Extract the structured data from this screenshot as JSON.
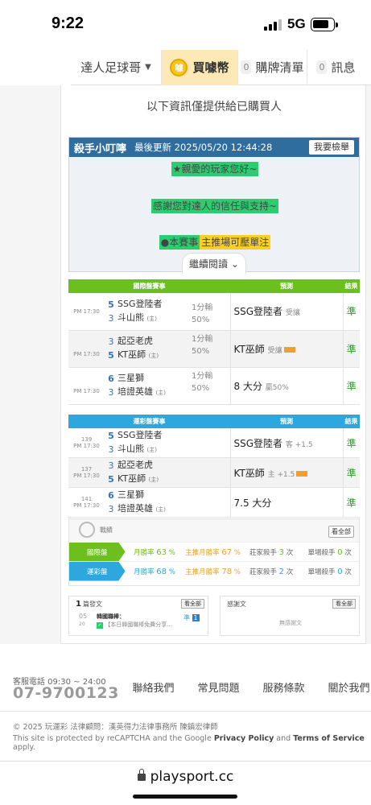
{
  "status": {
    "time": "9:22",
    "network": "5G"
  },
  "nav": {
    "user_label": "達人足球哥",
    "coin_label": "買噱幣",
    "coin_badge": "噱",
    "list_count": "0",
    "list_label": "購牌清單",
    "msg_count": "0",
    "msg_label": "訊息"
  },
  "notice": "以下資訊僅提供給已購買人",
  "killer": {
    "title": "殺手小叮嚀",
    "updated": "最後更新 2025/05/20 12:44:28",
    "report": "我要檢舉",
    "line1": "★親愛的玩家您好~",
    "line2": "感謝您對達人的信任與支持~",
    "line3a": "●本賽事",
    "line3b": "主推場可壓單注",
    "more": "繼續閱讀"
  },
  "intl": {
    "header": [
      "國際盤賽事",
      "預測",
      "結果"
    ],
    "rows": [
      {
        "time": "PM 17:30",
        "n1": "5",
        "t1": "SSG登陸者",
        "n2": "3",
        "t2": "斗山熊",
        "home": "(主)",
        "odds1": "1分輸",
        "odds2": "50%",
        "pick": "SSG登陸者",
        "sub": "受讓",
        "result": "準"
      },
      {
        "time": "PM 17:30",
        "n1": "3",
        "t1": "起亞老虎",
        "n2": "5",
        "t2": "KT巫師",
        "home": "(主)",
        "odds1": "1分輸",
        "odds2": "50%",
        "pick": "KT巫師",
        "sub": "受讓",
        "result": "準"
      },
      {
        "time": "PM 17:30",
        "n1": "6",
        "t1": "三星獅",
        "n2": "3",
        "t2": "培證英雄",
        "home": "(主)",
        "odds1": "1分輸",
        "odds2": "50%",
        "pick": "8 大分",
        "sub": "贏50%",
        "result": "準"
      }
    ]
  },
  "lottery": {
    "header": [
      "運彩盤賽事",
      "預測",
      "結果"
    ],
    "rows": [
      {
        "no": "139",
        "time": "PM 17:30",
        "n1": "5",
        "t1": "SSG登陸者",
        "n2": "3",
        "t2": "斗山熊",
        "home": "(主)",
        "pick": "SSG登陸者",
        "sub": "客 +1.5",
        "result": "準"
      },
      {
        "no": "137",
        "time": "PM 17:30",
        "n1": "3",
        "t1": "起亞老虎",
        "n2": "5",
        "t2": "KT巫師",
        "home": "(主)",
        "pick": "KT巫師",
        "sub": "主 +1.5",
        "result": "準"
      },
      {
        "no": "141",
        "time": "PM 17:30",
        "n1": "6",
        "t1": "三星獅",
        "n2": "3",
        "t2": "培證英雄",
        "home": "(主)",
        "pick": "7.5 大分",
        "sub": "",
        "result": "準"
      }
    ]
  },
  "stats": {
    "label": "戰績",
    "all": "看全部",
    "rows": [
      {
        "cat": "國際盤",
        "c1": "月勝率",
        "v1": "63",
        "u1": "%",
        "c2": "主推月勝率",
        "v2": "67",
        "u2": "%",
        "c3": "莊家殺手",
        "v3": "3",
        "u3": "次",
        "c4": "單場殺手",
        "v4": "0",
        "u4": "次"
      },
      {
        "cat": "運彩盤",
        "c1": "月勝率",
        "v1": "68",
        "u1": "%",
        "c2": "主推月勝率",
        "v2": "78",
        "u2": "%",
        "c3": "莊家殺手",
        "v3": "2",
        "u3": "次",
        "c4": "單場殺手",
        "v4": "0",
        "u4": "次"
      }
    ]
  },
  "articles": {
    "count": "1",
    "label": "篇發文",
    "all": "看全部",
    "date_m": "05",
    "date_d": "20",
    "item_title": "韓國職棒：",
    "item_text": "【本日韓國職棒免費分享...",
    "badge_a": "準",
    "badge_b": "1"
  },
  "thanks": {
    "label": "感謝文",
    "all": "看全部",
    "empty": "無感謝文"
  },
  "footer": {
    "tel_label": "客服電話 09:30 ~ 24:00",
    "tel": "07-9700123",
    "links": [
      "聯絡我們",
      "常見問題",
      "服務條款",
      "關於我們"
    ],
    "copyright": "© 2025 玩運彩 法律顧問：漢英得力法律事務所 陳鎮宏律師",
    "captcha_a": "This site is protected by reCAPTCHA and the Google ",
    "privacy": "Privacy Policy",
    "and": " and ",
    "terms": "Terms of Service",
    "apply": " apply."
  },
  "browser": {
    "url": "playsport.cc"
  }
}
